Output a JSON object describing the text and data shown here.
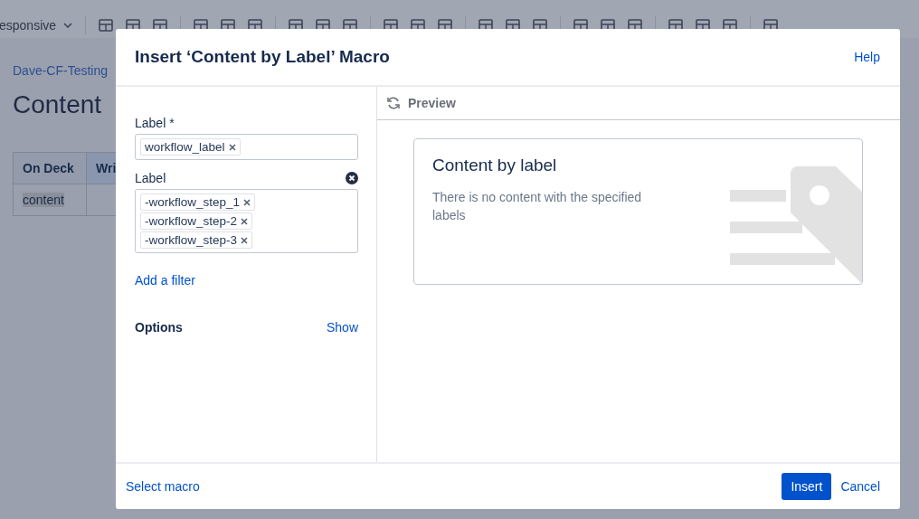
{
  "editor": {
    "toolbar": {
      "style_dropdown": "esponsive"
    },
    "breadcrumb": "Dave-CF-Testing",
    "page_title": "Content",
    "table": {
      "columns": [
        "On Deck",
        "Wri"
      ],
      "rows": [
        {
          "cells": [
            "content"
          ],
          "selected": true
        }
      ]
    }
  },
  "dialog": {
    "title": "Insert ‘Content by Label’ Macro",
    "help": "Help",
    "fields": [
      {
        "label": "Label *",
        "clearable": false,
        "tags": [
          "workflow_label"
        ]
      },
      {
        "label": "Label",
        "clearable": true,
        "tags": [
          "-workflow_step_1",
          "-workflow_step-2",
          "-workflow_step-3"
        ]
      }
    ],
    "add_filter": "Add a filter",
    "options": {
      "label": "Options",
      "toggle": "Show"
    },
    "preview": {
      "heading": "Preview",
      "card_title": "Content by label",
      "message": "There is no content with the specified labels"
    },
    "footer": {
      "select_macro": "Select macro",
      "insert": "Insert",
      "cancel": "Cancel"
    }
  }
}
